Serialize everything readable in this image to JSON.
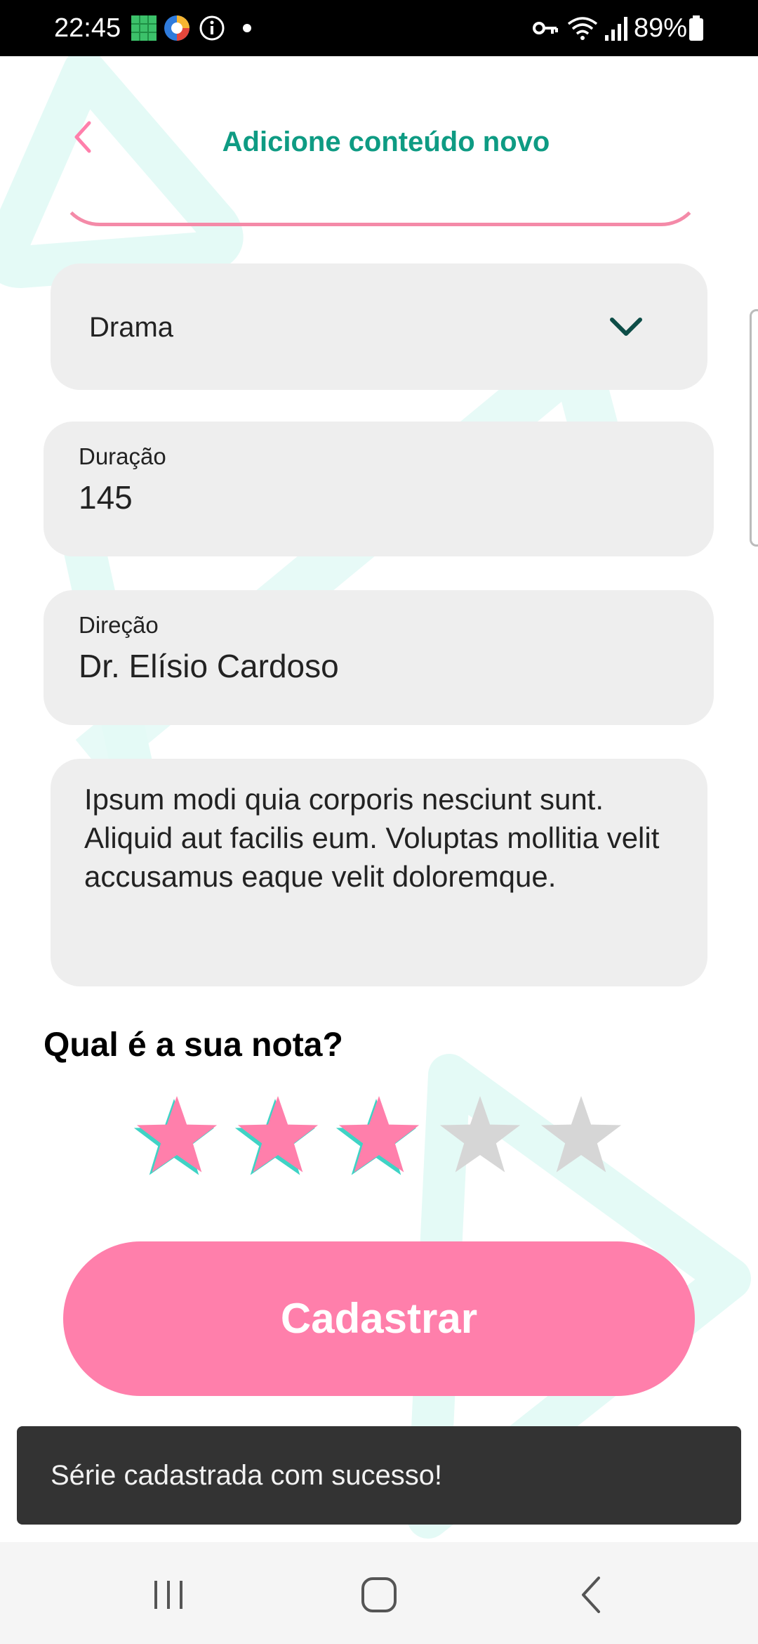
{
  "status_bar": {
    "time": "22:45",
    "battery": "89%",
    "icons": [
      "sheets-icon",
      "app-color-icon",
      "info-icon",
      "dot-icon",
      "vpn-key-icon",
      "wifi-icon",
      "signal-icon",
      "battery-icon"
    ]
  },
  "header": {
    "title": "Adicione conteúdo novo",
    "back_icon": "chevron-left-icon"
  },
  "form": {
    "genre": {
      "value": "Drama",
      "icon": "chevron-down-icon"
    },
    "duration": {
      "label": "Duração",
      "value": "145"
    },
    "director": {
      "label": "Direção",
      "value": "Dr. Elísio Cardoso"
    },
    "description": {
      "value": "Ipsum modi quia corporis nesciunt sunt. Aliquid aut facilis eum. Voluptas mollitia velit accusamus eaque velit doloremque."
    }
  },
  "rating": {
    "question": "Qual é a sua nota?",
    "value": 3,
    "max": 5
  },
  "submit": {
    "label": "Cadastrar"
  },
  "snackbar": {
    "message": "Série cadastrada com sucesso!"
  },
  "nav_bar": {
    "icons": [
      "recent-apps-icon",
      "home-icon",
      "back-icon"
    ]
  },
  "colors": {
    "accent_teal": "#0e9b83",
    "accent_pink": "#ff7fab",
    "star_filled": "#ff7fab",
    "star_empty": "#d6d6d6",
    "field_bg": "#eeeeee",
    "snackbar_bg": "#333333"
  }
}
